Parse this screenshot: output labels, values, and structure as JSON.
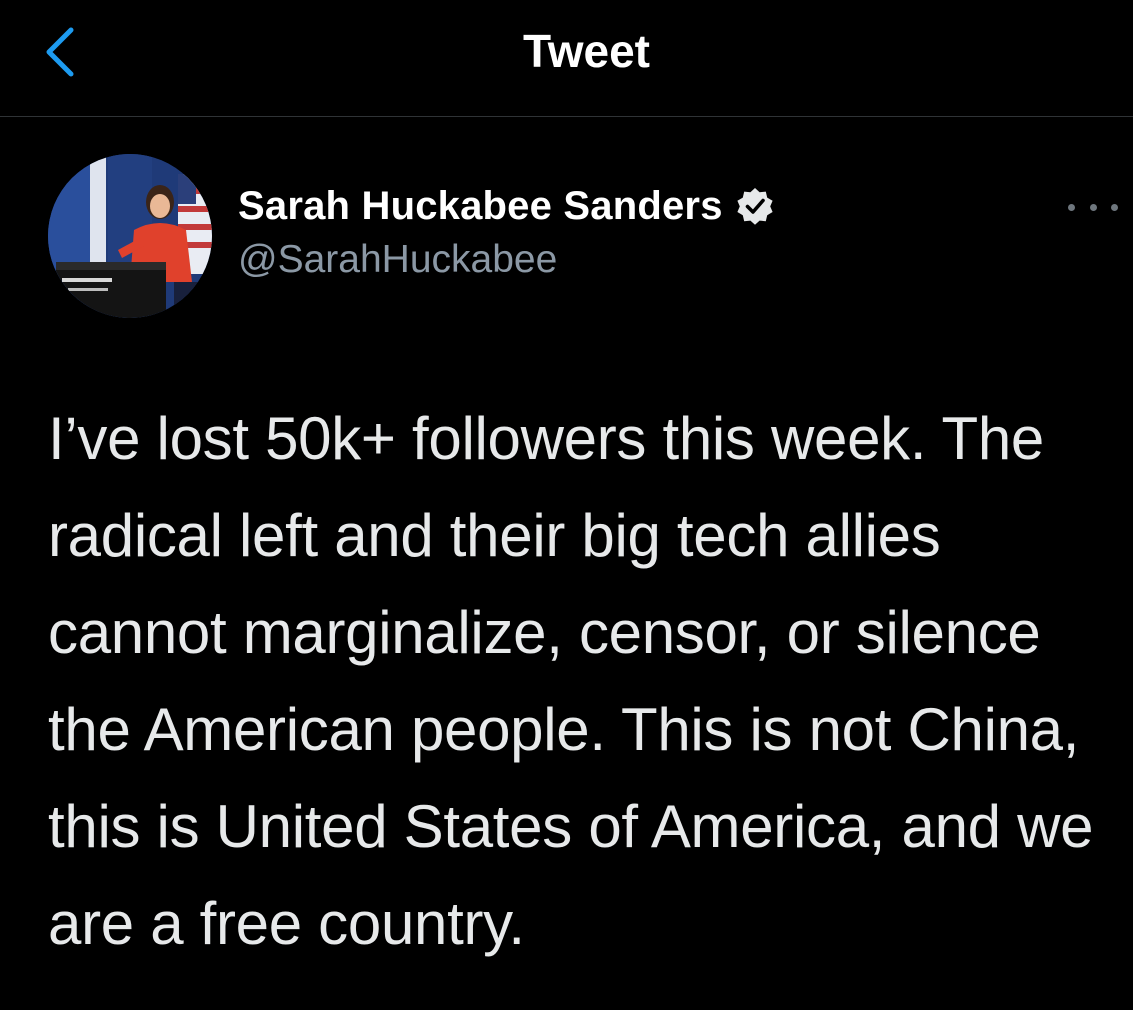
{
  "header": {
    "title": "Tweet",
    "back_icon": "chevron-left-icon",
    "accent_color": "#1d9bf0"
  },
  "tweet": {
    "author": {
      "display_name": "Sarah Huckabee Sanders",
      "handle": "@SarahHuckabee",
      "verified": true,
      "verified_icon": "verified-badge-icon"
    },
    "more_icon": "more-options-icon",
    "text": "I’ve lost 50k+ followers this week. The radical left and their big tech allies cannot marginalize, censor, or silence the American people. This is not China, this is United States of America, and we are a free country."
  },
  "colors": {
    "background": "#000000",
    "primary_text": "#e7e9ea",
    "secondary_text": "#8b98a5",
    "divider": "#2f3336"
  }
}
